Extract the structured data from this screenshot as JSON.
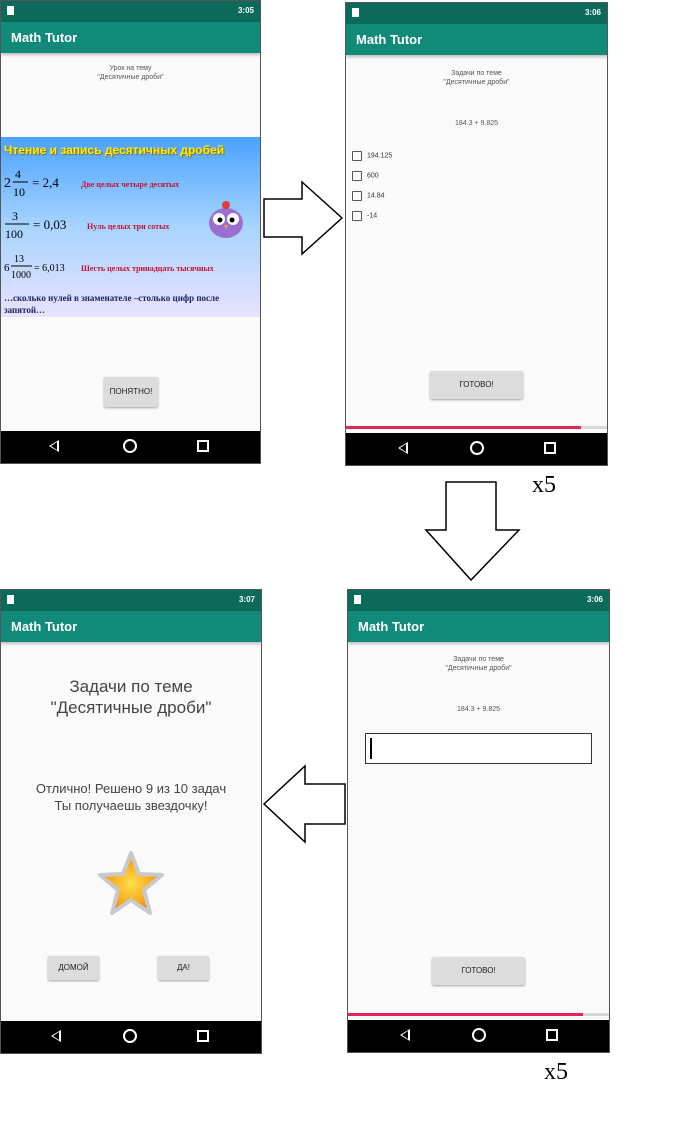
{
  "app_title": "Math Tutor",
  "screen1": {
    "clock": "3:05",
    "lesson_heading_line1": "Урок на тему",
    "lesson_heading_line2": "\"Десятичные дроби\"",
    "slide_title": "Чтение и запись десятичных дробей",
    "ex1_math": "2 4/10 = 2,4",
    "ex1_text": "Две целых четыре десятых",
    "ex2_math": "3/100 = 0,03",
    "ex2_text": "Нуль целых три сотых",
    "ex3_math": "6 13/1000 = 6,013",
    "ex3_text": "Шесть целых тринадцать тысячных",
    "rule_text": "…сколько нулей в знаменателе –столько цифр после запятой…",
    "button": "ПОНЯТНО!"
  },
  "screen2": {
    "clock": "3:06",
    "heading_line1": "Задачи по теме",
    "heading_line2": "\"Десятичные дроби\"",
    "expression": "184.3 + 9.825",
    "options": [
      "194.125",
      "600",
      "14.84",
      "-14"
    ],
    "button": "ГОТОВО!",
    "progress": 0.9
  },
  "screen3": {
    "clock": "3:06",
    "heading_line1": "Задачи по теме",
    "heading_line2": "\"Десятичные дроби\"",
    "expression": "184.3 + 9.825",
    "input_value": "",
    "button": "ГОТОВО!",
    "progress": 0.9
  },
  "screen4": {
    "clock": "3:07",
    "heading_line1": "Задачи по теме",
    "heading_line2": "\"Десятичные дроби\"",
    "result_line1": "Отлично! Решено 9 из 10 задач",
    "result_line2": "Ты получаешь звездочку!",
    "home_button": "ДОМОЙ",
    "yes_button": "ДА!"
  },
  "repeat_label_1": "x5",
  "repeat_label_2": "x5",
  "colors": {
    "statusbar": "#0b6a5a",
    "appbar": "#128a79",
    "progress": "#e0245e"
  }
}
